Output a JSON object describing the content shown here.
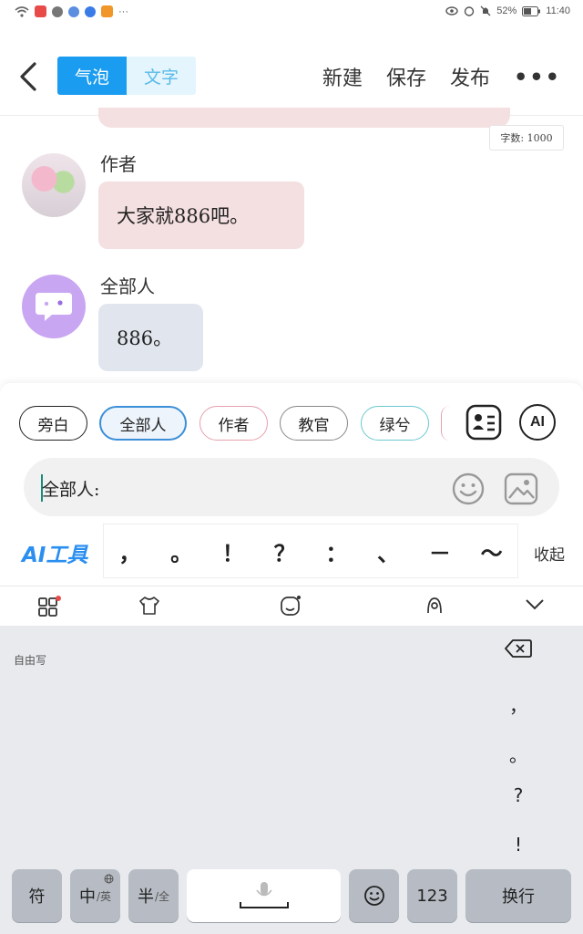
{
  "status_bar": {
    "battery": "52%",
    "time": "11:40"
  },
  "header": {
    "tabs": [
      {
        "label": "气泡"
      },
      {
        "label": "文字"
      }
    ],
    "actions": {
      "new": "新建",
      "save": "保存",
      "publish": "发布",
      "more": "•••"
    }
  },
  "chat": {
    "word_count": "字数: 1000",
    "messages": [
      {
        "speaker": "作者",
        "text": "大家就886吧。"
      },
      {
        "speaker": "全部人",
        "text": "886。"
      }
    ]
  },
  "roles": {
    "chips": [
      "旁白",
      "全部人",
      "作者",
      "教官",
      "绿兮"
    ],
    "ai_button": "AI"
  },
  "composer": {
    "value": "全部人:"
  },
  "toolbar": {
    "ai_tools": "AI工具",
    "punctuation": [
      "，",
      "。",
      "！",
      "？",
      "：",
      "、",
      "－",
      "～"
    ],
    "collapse": "收起"
  },
  "keyboard": {
    "mode_label": "自由写",
    "side_punct": [
      "，",
      "。",
      "?",
      "!"
    ],
    "keys": {
      "symbol": "符",
      "zh": "中",
      "zh_sub": "/英",
      "half": "半",
      "half_sub": "/全",
      "num": "123",
      "enter": "换行"
    }
  },
  "colors": {
    "accent": "#1a9cf0",
    "author_bubble": "#f4dfe1",
    "all_bubble": "#e1e6ee"
  }
}
